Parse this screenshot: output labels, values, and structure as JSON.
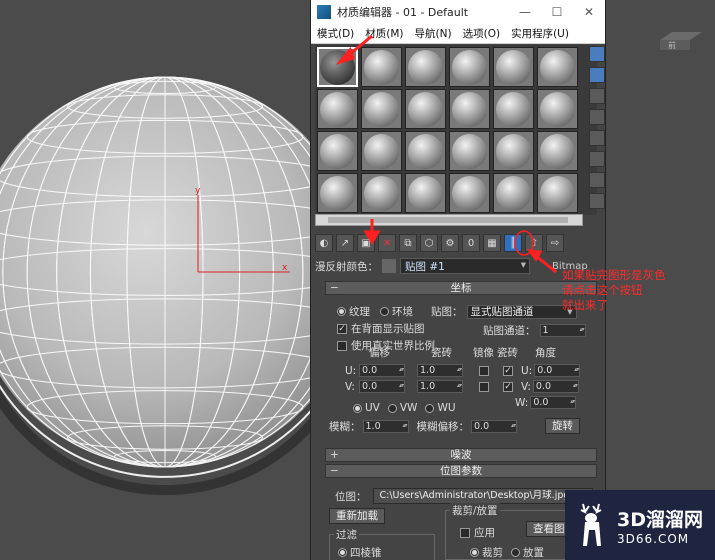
{
  "viewport": {
    "axis_x": "x",
    "axis_y": "y",
    "badge_label": "前"
  },
  "window": {
    "title": "材质编辑器 - 01 - Default",
    "minimize": "—",
    "maximize": "☐",
    "close": "✕"
  },
  "menu": [
    "模式(D)",
    "材质(M)",
    "导航(N)",
    "选项(O)",
    "实用程序(U)"
  ],
  "slots": {
    "rows": 4,
    "cols": 6,
    "active_index": 0
  },
  "diffuse": {
    "label": "漫反射颜色：",
    "map_name": "贴图 #1",
    "map_type": "Bitmap"
  },
  "coords_rollout": {
    "header": "坐标",
    "texture_label": "纹理",
    "environ_label": "环境",
    "mapping_label": "贴图：",
    "mapping_value": "显式贴图通道",
    "show_on_back": "在背面显示贴图",
    "real_world": "使用真实世界比例",
    "map_channel_label": "贴图通道：",
    "map_channel_value": "1",
    "col_offset": "偏移",
    "col_tiling": "瓷砖",
    "col_mirror": "镜像",
    "col_tile": "瓷砖",
    "col_angle": "角度",
    "u_label": "U:",
    "v_label": "V:",
    "w_label": "W:",
    "u_offset": "0.0",
    "v_offset": "0.0",
    "u_tiling": "1.0",
    "v_tiling": "1.0",
    "u_angle": "0.0",
    "v_angle": "0.0",
    "w_angle": "0.0",
    "uv": "UV",
    "vw": "VW",
    "wu": "WU",
    "blur_label": "模糊：",
    "blur_value": "1.0",
    "blur_offset_label": "模糊偏移：",
    "blur_offset_value": "0.0",
    "rotate_button": "旋转"
  },
  "noise_rollout": {
    "header": "噪波"
  },
  "bitmap_rollout": {
    "header": "位图参数",
    "bitmap_label": "位图：",
    "bitmap_path": "C:\\Users\\Administrator\\Desktop\\月球.jpg",
    "reload_button": "重新加载",
    "crop_group": "裁剪/放置",
    "apply_label": "应用",
    "view_image_button": "查看图像",
    "filter_group": "过滤",
    "pyramidal_label": "四棱锥",
    "crop_label": "裁剪",
    "place_label": "放置"
  },
  "annotation": {
    "line1": "如果贴完图形是灰色",
    "line2": "请点击这个按钮",
    "line3": "就出来了"
  },
  "watermark": {
    "brand": "3D溜溜网",
    "domain": "3D66.COM"
  }
}
